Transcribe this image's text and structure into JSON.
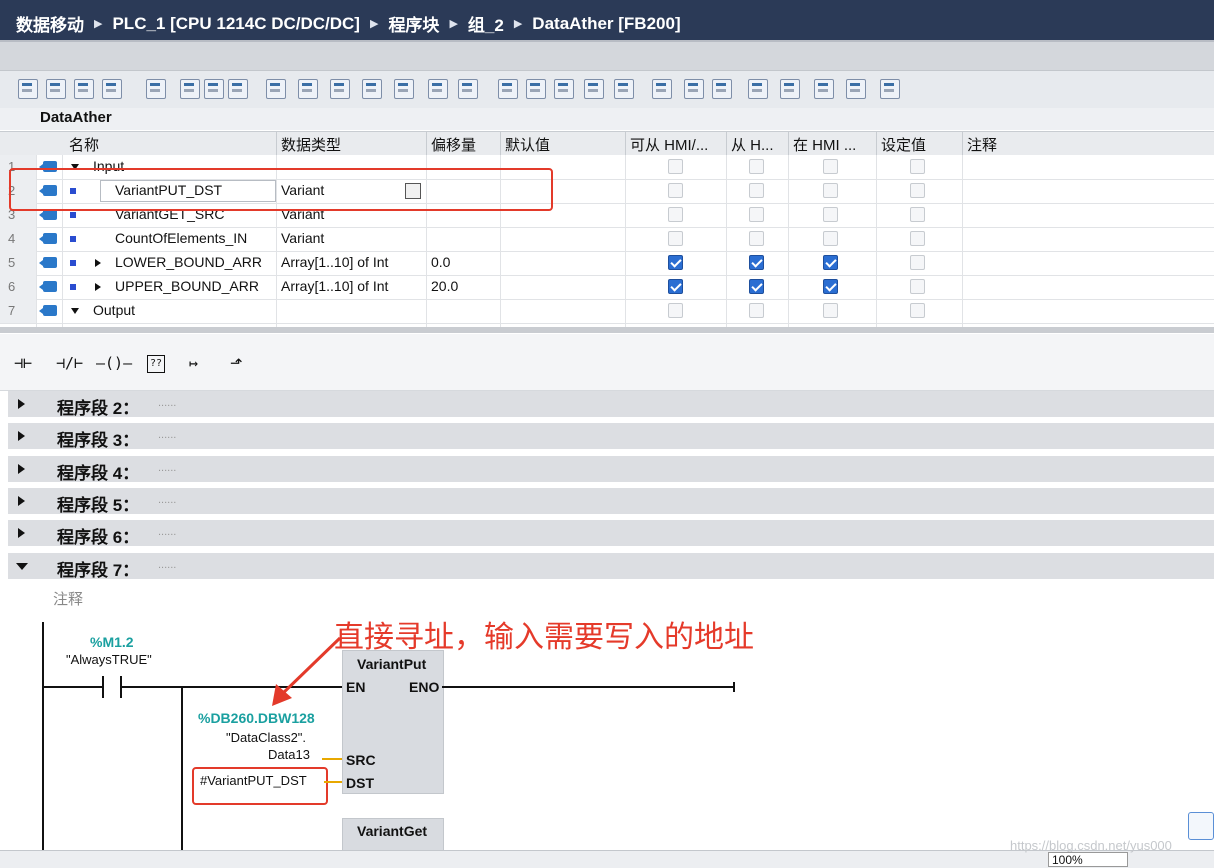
{
  "breadcrumb": {
    "items": [
      "数据移动",
      "PLC_1 [CPU 1214C DC/DC/DC]",
      "程序块",
      "组_2",
      "DataAther [FB200]"
    ]
  },
  "block_interface": {
    "title": "DataAther",
    "columns": [
      "名称",
      "数据类型",
      "偏移量",
      "默认值",
      "可从 HMI/...",
      "从 H...",
      "在 HMI ...",
      "设定值",
      "注释"
    ],
    "rows": [
      {
        "num": "1",
        "name": "Input",
        "type": "",
        "default": "",
        "hmi1": false,
        "hmi2": false,
        "hmi3": false,
        "set": false,
        "section": true
      },
      {
        "num": "2",
        "name": "VariantPUT_DST",
        "type": "Variant",
        "default": "",
        "hmi1": false,
        "hmi2": false,
        "hmi3": false,
        "set": false
      },
      {
        "num": "3",
        "name": "VariantGET_SRC",
        "type": "Variant",
        "default": "",
        "hmi1": false,
        "hmi2": false,
        "hmi3": false,
        "set": false
      },
      {
        "num": "4",
        "name": "CountOfElements_IN",
        "type": "Variant",
        "default": "",
        "hmi1": false,
        "hmi2": false,
        "hmi3": false,
        "set": false
      },
      {
        "num": "5",
        "name": "LOWER_BOUND_ARR",
        "type": "Array[1..10] of Int",
        "default": "0.0",
        "hmi1": true,
        "hmi2": true,
        "hmi3": true,
        "set": false
      },
      {
        "num": "6",
        "name": "UPPER_BOUND_ARR",
        "type": "Array[1..10] of Int",
        "default": "20.0",
        "hmi1": true,
        "hmi2": true,
        "hmi3": true,
        "set": false
      },
      {
        "num": "7",
        "name": "Output",
        "type": "",
        "default": "",
        "hmi1": false,
        "hmi2": false,
        "hmi3": false,
        "set": false,
        "section": true
      }
    ]
  },
  "ladder_toolbar": {
    "no_contact": "⊣⊢",
    "nc_contact": "⊣/⊢",
    "coil": "—()—",
    "empty_box": "??",
    "open_branch": "↦",
    "close_branch": "⬏"
  },
  "networks": [
    {
      "label": "程序段 2：",
      "comment": "......",
      "expanded": false
    },
    {
      "label": "程序段 3：",
      "comment": "......",
      "expanded": false
    },
    {
      "label": "程序段 4：",
      "comment": "......",
      "expanded": false
    },
    {
      "label": "程序段 5：",
      "comment": "......",
      "expanded": false
    },
    {
      "label": "程序段 6：",
      "comment": "......",
      "expanded": false
    },
    {
      "label": "程序段 7：",
      "comment": "......",
      "expanded": true
    }
  ],
  "network7": {
    "comment_placeholder": "注释",
    "contact_address": "%M1.2",
    "contact_symbol": "\"AlwaysTRUE\"",
    "put_block": "VariantPut",
    "en": "EN",
    "eno": "ENO",
    "src_address": "%DB260.DBW128",
    "src_symbol_1": "\"DataClass2\".",
    "src_symbol_2": "Data13",
    "src_pin": "SRC",
    "dst_pin": "DST",
    "dst_operand": "#VariantPUT_DST",
    "get_block": "VariantGet",
    "annotation": "直接寻址，输入需要写入的地址"
  },
  "status": {
    "zoom": "100%",
    "watermark": "https://blog.csdn.net/yus000"
  },
  "colors": {
    "title_bar": "#2b3a57",
    "accent_red": "#e33a2a",
    "teal": "#1aa0a0",
    "checkbox_on": "#2b6ed2"
  }
}
